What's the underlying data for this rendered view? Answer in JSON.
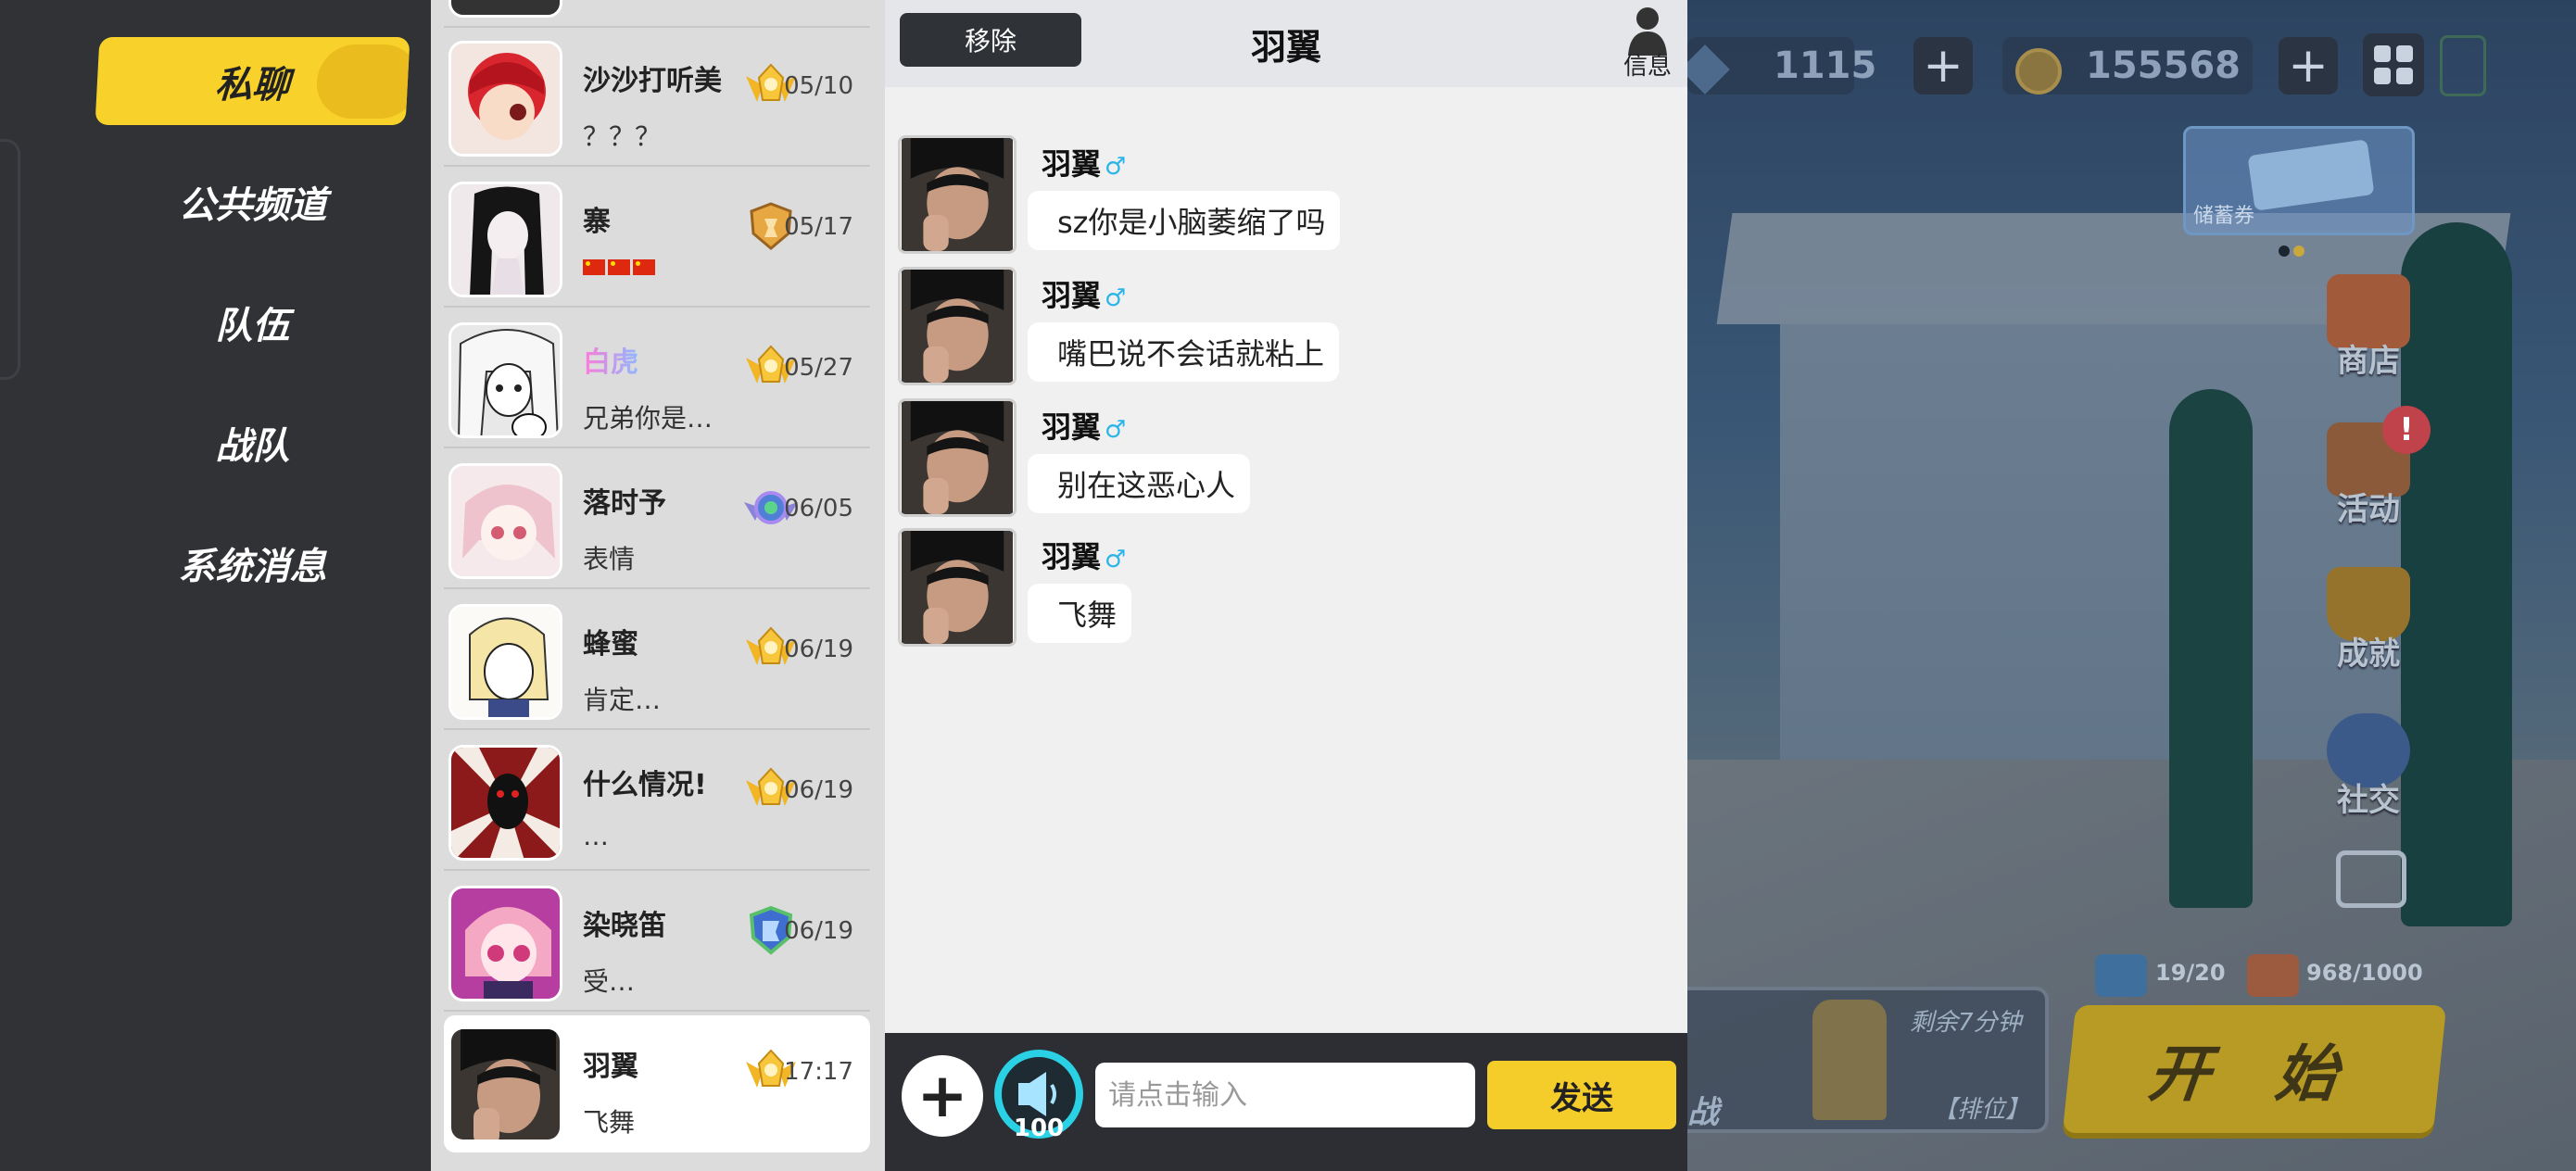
{
  "sidebar": {
    "items": [
      {
        "label": "私聊",
        "active": true
      },
      {
        "label": "公共频道",
        "active": false
      },
      {
        "label": "队伍",
        "active": false
      },
      {
        "label": "战队",
        "active": false
      },
      {
        "label": "系统消息",
        "active": false
      }
    ]
  },
  "conversations": [
    {
      "name": "沙沙打听美",
      "preview": "？？？",
      "date": "05/10",
      "badge": "gold-wings-badge"
    },
    {
      "name": "寨",
      "preview": "",
      "preview_icon": "china-flag-icons",
      "date": "05/17",
      "badge": "bronze-shield-badge"
    },
    {
      "name": "白虎",
      "preview": "兄弟你是…",
      "date": "05/27",
      "badge": "gold-wings-badge",
      "name_style": "gradient"
    },
    {
      "name": "落时予",
      "preview": "表情",
      "date": "06/05",
      "badge": "rainbow-gem-badge"
    },
    {
      "name": "蜂蜜",
      "preview": "肯定…",
      "date": "06/19",
      "badge": "gold-wings-badge"
    },
    {
      "name": "什么情况!",
      "preview": "…",
      "date": "06/19",
      "badge": "gold-wings-badge"
    },
    {
      "name": "染晓笛",
      "preview": "受…",
      "date": "06/19",
      "badge": "green-shield-badge"
    },
    {
      "name": "羽翼",
      "preview": "飞舞",
      "date": "17:17",
      "badge": "gold-wings-badge",
      "selected": true
    }
  ],
  "chat": {
    "remove_label": "移除",
    "title": "羽翼",
    "info_label": "信息",
    "messages": [
      {
        "sender": "羽翼",
        "gender": "♂",
        "text": "sz你是小脑萎缩了吗"
      },
      {
        "sender": "羽翼",
        "gender": "♂",
        "text": "嘴巴说不会话就粘上"
      },
      {
        "sender": "羽翼",
        "gender": "♂",
        "text": "别在这恶心人"
      },
      {
        "sender": "羽翼",
        "gender": "♂",
        "text": "飞舞"
      }
    ],
    "input_placeholder": "请点击输入",
    "voice_count": "100",
    "send_label": "发送"
  },
  "scene": {
    "gems": "1115",
    "coins": "155568",
    "voucher_label": "储蓄券",
    "side_buttons": [
      {
        "label": "商店",
        "icon": "shop-icon"
      },
      {
        "label": "活动",
        "icon": "event-icon",
        "alert": "!"
      },
      {
        "label": "成就",
        "icon": "trophy-icon"
      },
      {
        "label": "社交",
        "icon": "social-icon"
      }
    ],
    "mode_timer": "剩余7分钟",
    "mode_tag": "【排位】",
    "mode_name": "战",
    "counter_1": "19/20",
    "counter_2": "968/1000",
    "start_label": "开 始"
  },
  "colors": {
    "accent_yellow": "#f8d22a",
    "sidebar_bg": "#303236",
    "chat_bg": "#f0f0f0",
    "gender_blue": "#2ab5e8"
  }
}
